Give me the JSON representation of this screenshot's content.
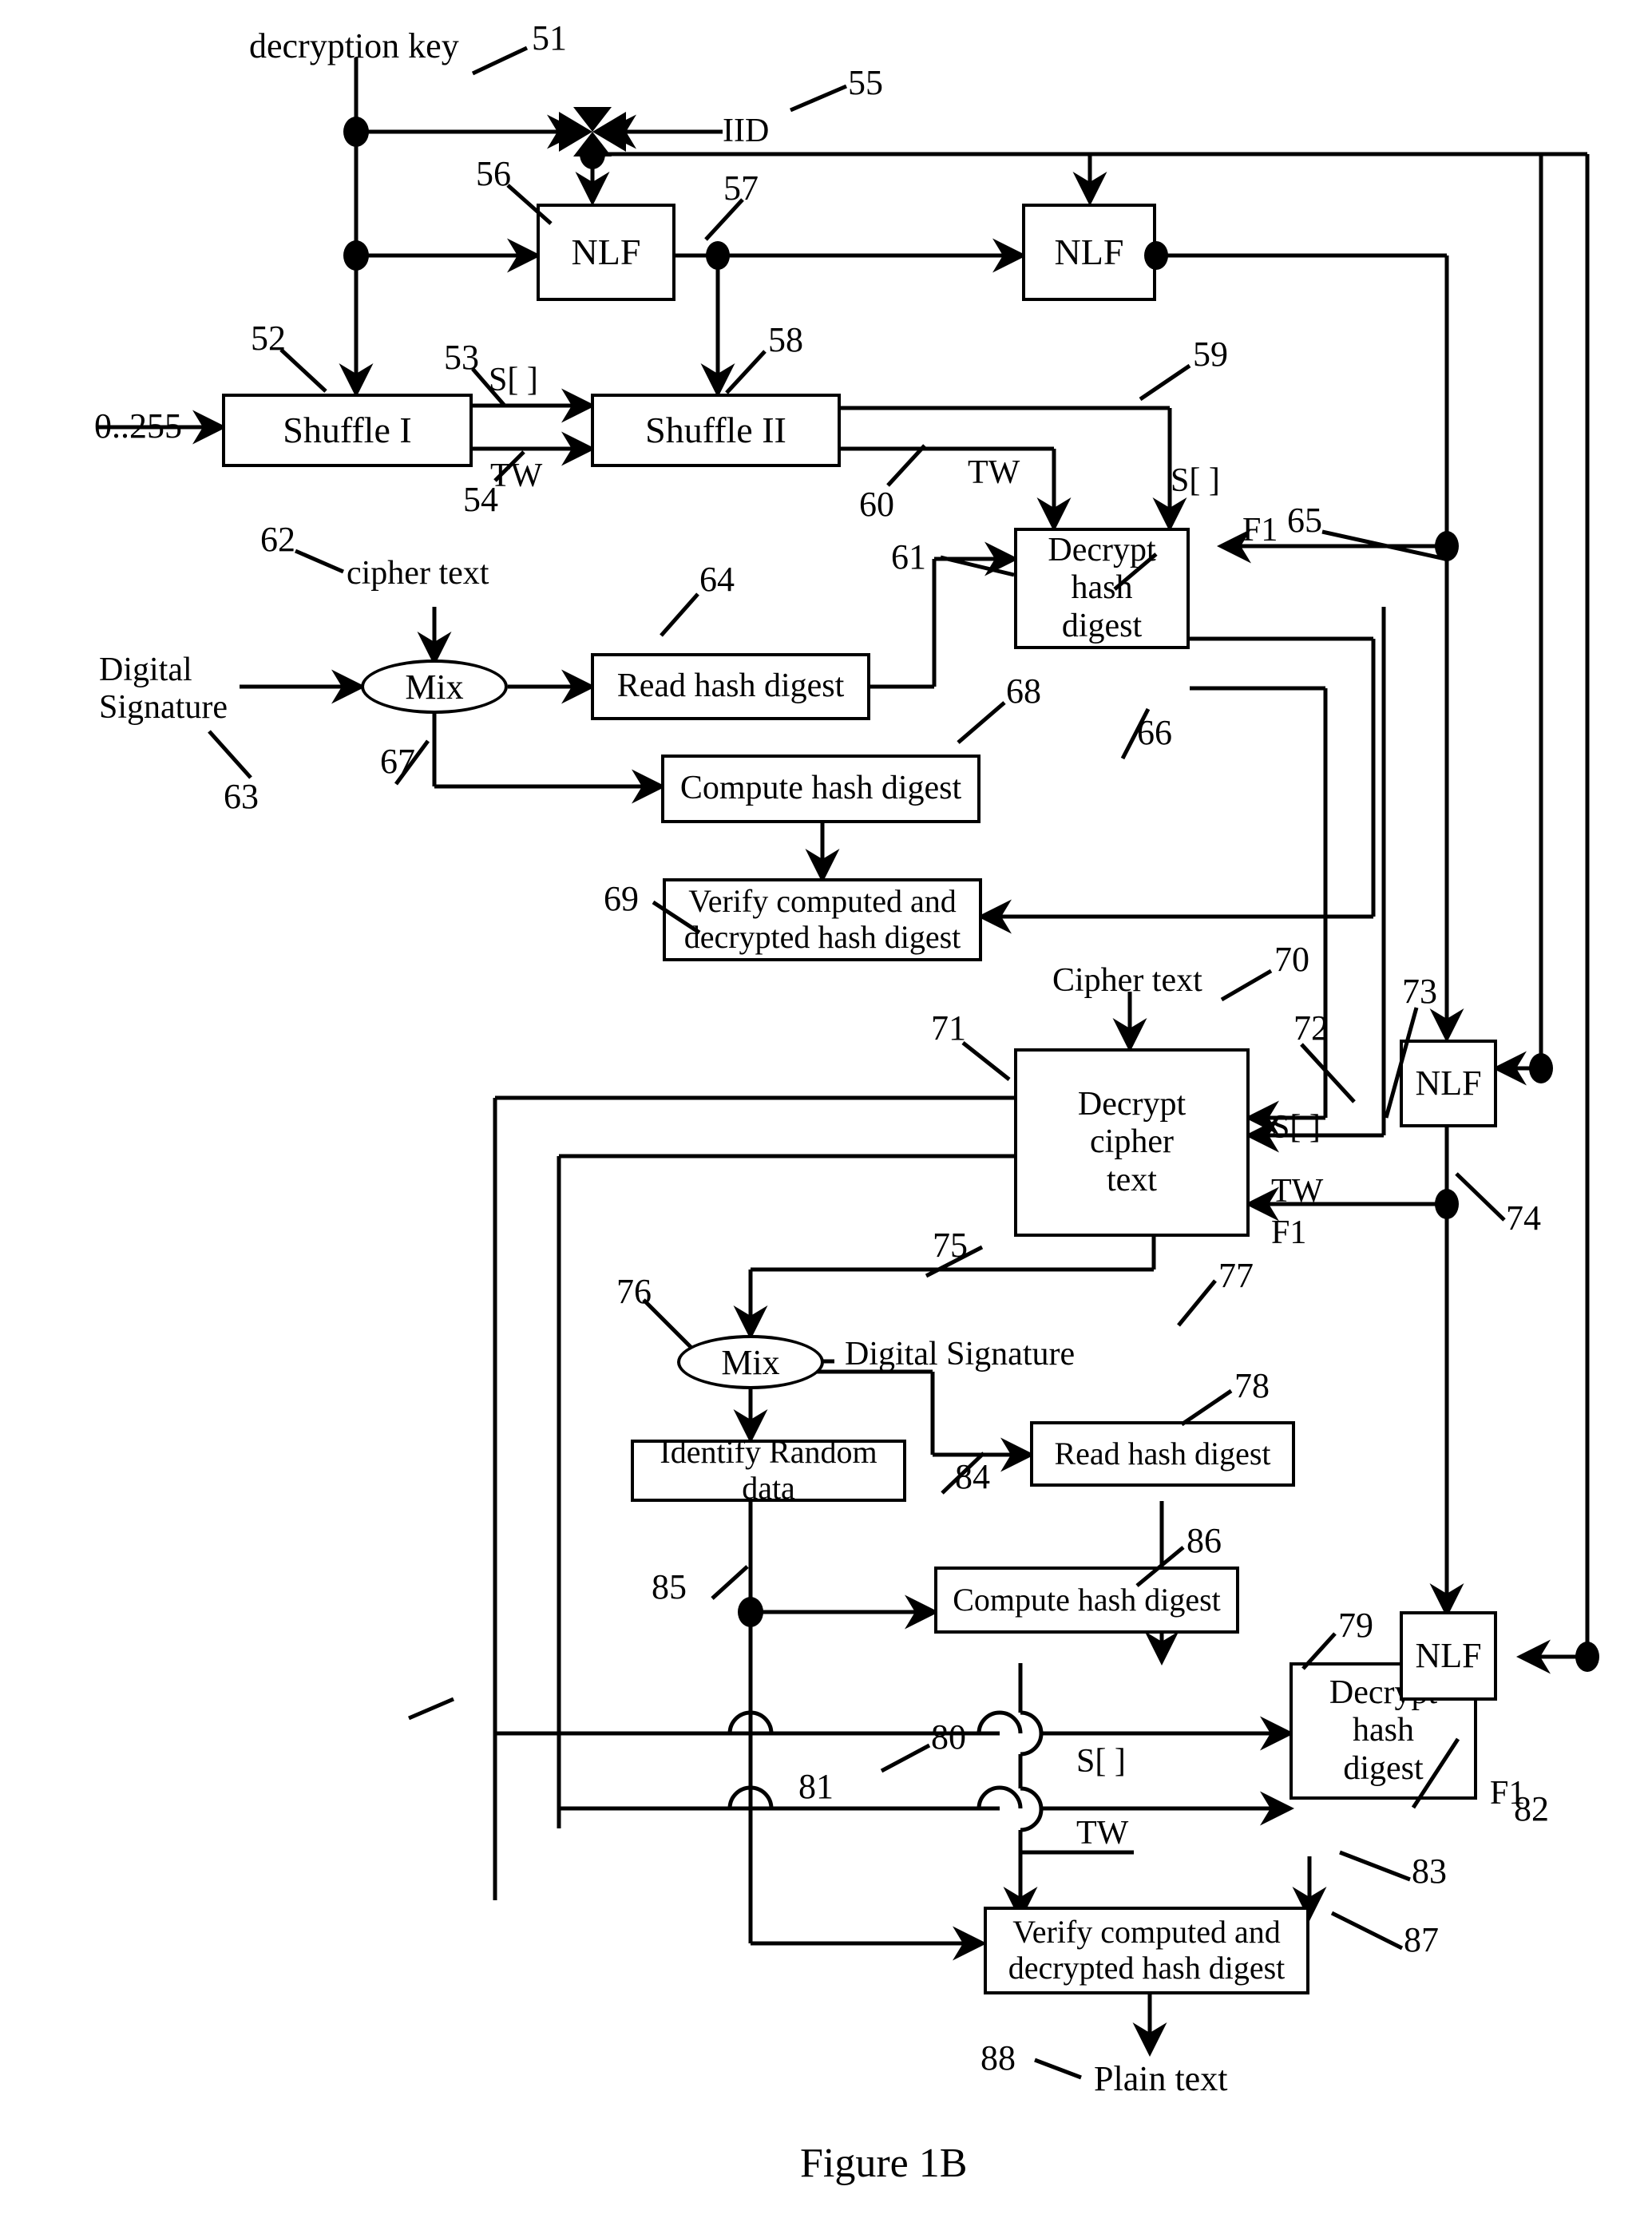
{
  "figure": {
    "caption": "Figure 1B"
  },
  "nodes": [
    {
      "id": "nlf56",
      "label": "NLF"
    },
    {
      "id": "nlf_top_r",
      "label": "NLF"
    },
    {
      "id": "shuffle1",
      "label": "Shuffle I"
    },
    {
      "id": "shuffle2",
      "label": "Shuffle II"
    },
    {
      "id": "decrypt_hd1",
      "label": "Decrypt\nhash\ndigest"
    },
    {
      "id": "mix1",
      "label": "Mix"
    },
    {
      "id": "read_hd1",
      "label": "Read hash digest"
    },
    {
      "id": "compute_hd1",
      "label": "Compute hash digest"
    },
    {
      "id": "verify1",
      "label": "Verify computed and\ndecrypted hash digest"
    },
    {
      "id": "decrypt_ct",
      "label": "Decrypt\ncipher\ntext"
    },
    {
      "id": "nlf73",
      "label": "NLF"
    },
    {
      "id": "mix2",
      "label": "Mix"
    },
    {
      "id": "identify_rd",
      "label": "Identify Random data"
    },
    {
      "id": "read_hd2",
      "label": "Read hash digest"
    },
    {
      "id": "compute_hd2",
      "label": "Compute hash digest"
    },
    {
      "id": "decrypt_hd2",
      "label": "Decrypt\nhash\ndigest"
    },
    {
      "id": "nlf82",
      "label": "NLF"
    },
    {
      "id": "verify2",
      "label": "Verify computed and\ndecrypted hash digest"
    }
  ],
  "signals": {
    "decryption_key": "decryption key",
    "iid": "IID",
    "range": "0..255",
    "s_array_1": "S[ ]",
    "tw_1": "TW",
    "s_array_2": "S[ ]",
    "tw_2": "TW",
    "f1_1": "F1",
    "cipher_text_lower": "cipher text",
    "digital_signature_1": "Digital\nSignature",
    "cipher_text_upper": "Cipher text",
    "s_array_3": "S[ ]",
    "tw_3": "TW",
    "f1_2": "F1",
    "digital_signature_2": "Digital Signature",
    "s_array_4": "S[ ]",
    "tw_4": "TW",
    "f1_3": "F1",
    "plain_text": "Plain text"
  },
  "reference_numerals": [
    "51",
    "52",
    "53",
    "54",
    "55",
    "56",
    "57",
    "58",
    "59",
    "60",
    "61",
    "62",
    "63",
    "64",
    "65",
    "66",
    "67",
    "68",
    "69",
    "70",
    "71",
    "72",
    "73",
    "74",
    "75",
    "76",
    "77",
    "78",
    "79",
    "80",
    "81",
    "82",
    "83",
    "84",
    "85",
    "86",
    "87",
    "88"
  ],
  "refs": {
    "r51": "51",
    "r52": "52",
    "r53": "53",
    "r54": "54",
    "r55": "55",
    "r56": "56",
    "r57": "57",
    "r58": "58",
    "r59": "59",
    "r60": "60",
    "r61": "61",
    "r62": "62",
    "r63": "63",
    "r64": "64",
    "r65": "65",
    "r66": "66",
    "r67": "67",
    "r68": "68",
    "r69": "69",
    "r70": "70",
    "r71": "71",
    "r72": "72",
    "r73": "73",
    "r74": "74",
    "r75": "75",
    "r76": "76",
    "r77": "77",
    "r78": "78",
    "r79": "79",
    "r80": "80",
    "r81": "81",
    "r82": "82",
    "r83": "83",
    "r84": "84",
    "r85": "85",
    "r86": "86",
    "r87": "87",
    "r88": "88"
  },
  "style": {
    "ink": "#000000",
    "paper": "#ffffff"
  }
}
